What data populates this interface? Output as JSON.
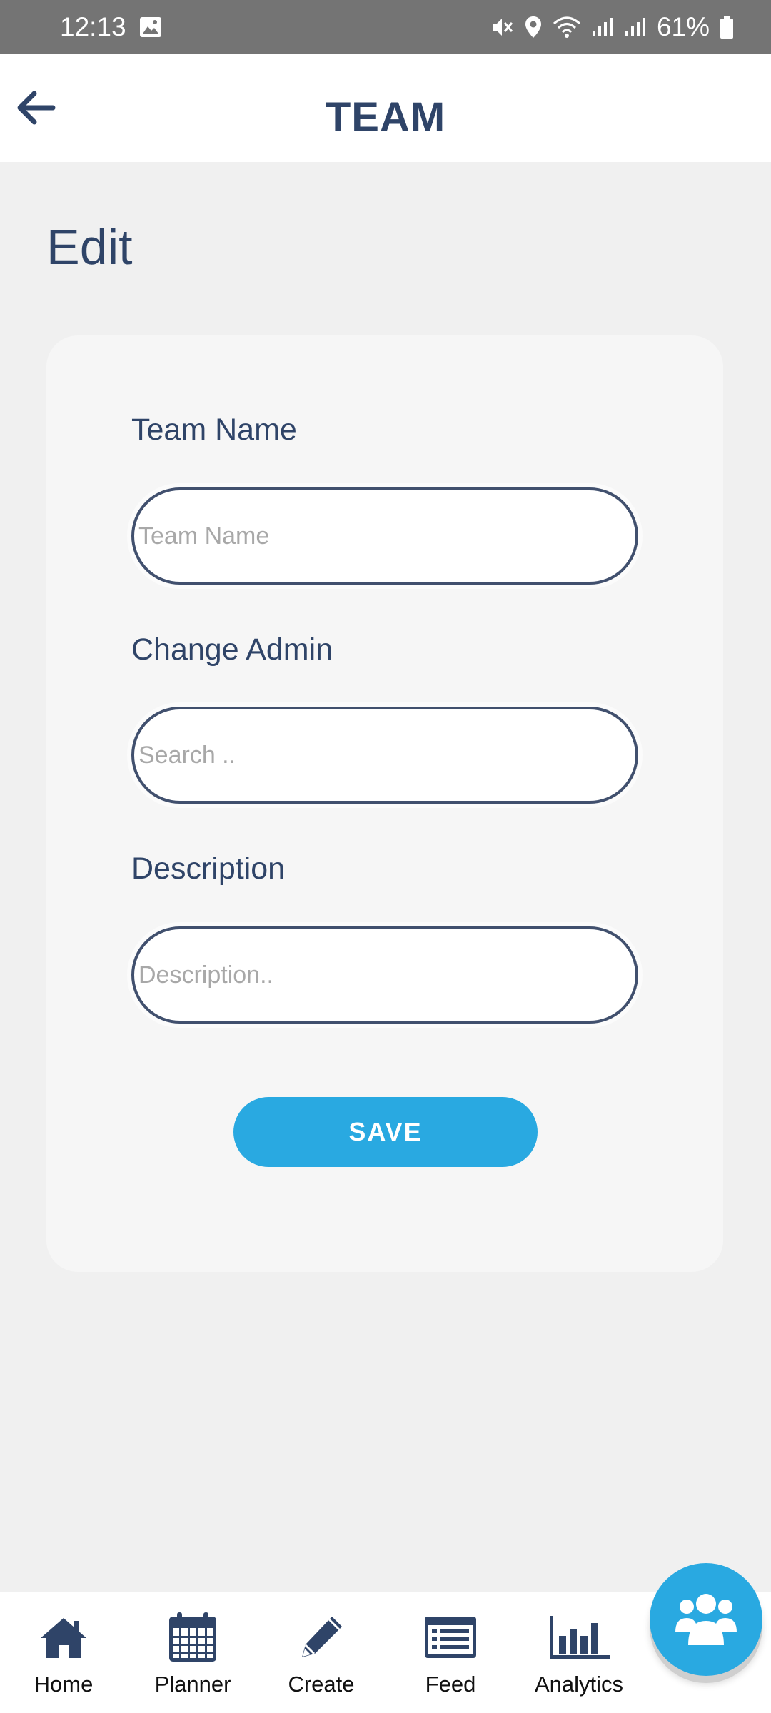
{
  "status_bar": {
    "time": "12:13",
    "battery": "61%",
    "icons": [
      "image-icon",
      "mute-icon",
      "location-icon",
      "wifi-icon",
      "signal-icon",
      "signal-icon",
      "battery-icon"
    ]
  },
  "app_bar": {
    "title": "TEAM",
    "back_icon": "arrow-left-icon"
  },
  "page": {
    "heading": "Edit"
  },
  "form": {
    "team_name": {
      "label": "Team Name",
      "placeholder": "Team Name",
      "value": ""
    },
    "change_admin": {
      "label": "Change Admin",
      "placeholder": "Search ..",
      "value": ""
    },
    "description": {
      "label": "Description",
      "placeholder": "Description..",
      "value": ""
    },
    "save_label": "SAVE"
  },
  "bottom_nav": {
    "items": [
      {
        "label": "Home",
        "icon": "home-icon"
      },
      {
        "label": "Planner",
        "icon": "calendar-icon"
      },
      {
        "label": "Create",
        "icon": "pencil-icon"
      },
      {
        "label": "Feed",
        "icon": "feed-icon"
      },
      {
        "label": "Analytics",
        "icon": "bar-chart-icon"
      }
    ]
  },
  "fab": {
    "icon": "team-icon"
  },
  "colors": {
    "primary_navy": "#2f4468",
    "accent_blue": "#29a9e1",
    "status_bar": "#747474",
    "background": "#f0f0f0",
    "card": "#f6f6f6"
  }
}
